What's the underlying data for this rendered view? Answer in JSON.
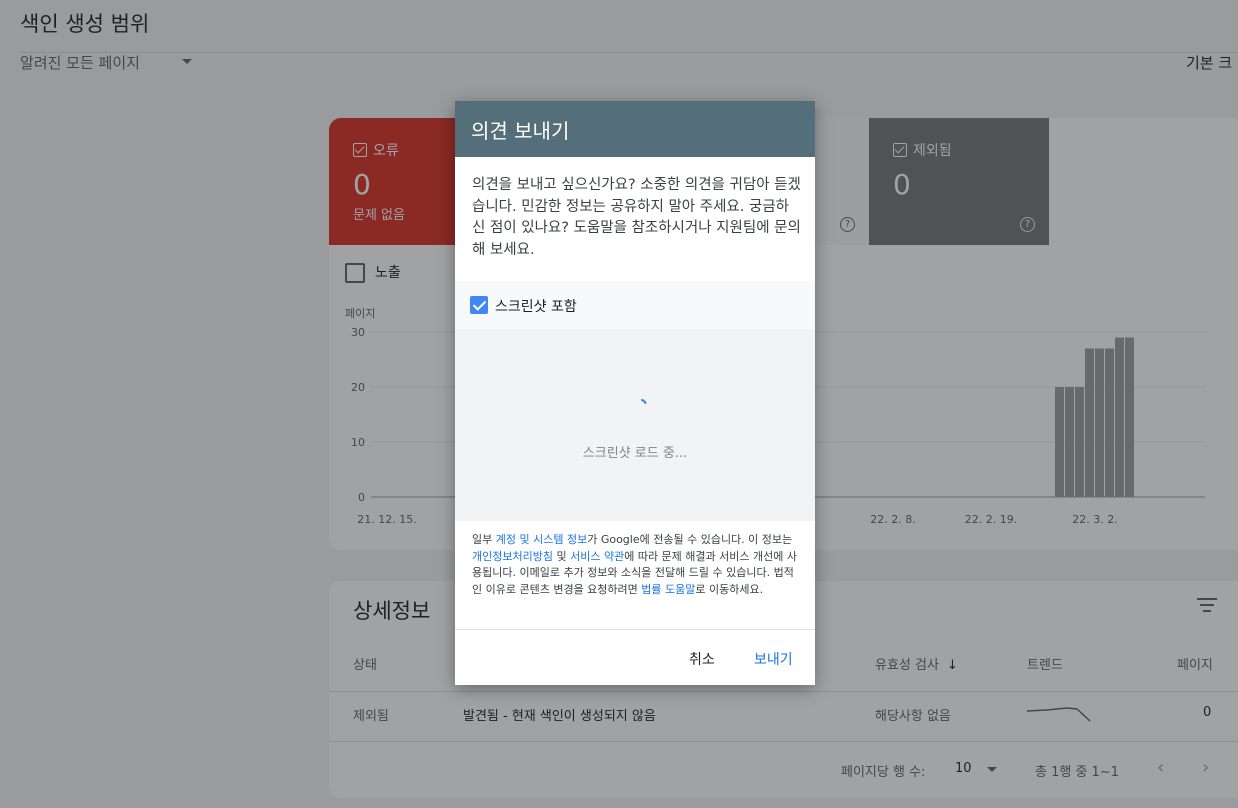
{
  "page": {
    "title": "색인 생성 범위",
    "filter_label": "알려진 모든 페이지",
    "top_right_text": "기본 크"
  },
  "summary": {
    "error": {
      "label": "오류",
      "count": "0",
      "sub": "문제 없음"
    },
    "excluded": {
      "label": "제외됨",
      "count": "0"
    },
    "impressions_label": "노출"
  },
  "chart_data": {
    "type": "bar",
    "ylabel": "페이지",
    "ylim": [
      0,
      30
    ],
    "yticks": [
      0,
      10,
      20,
      30
    ],
    "xtick_labels": [
      "21. 12. 15.",
      "22. 2. 8.",
      "22. 2. 19.",
      "22. 3. 2."
    ],
    "series": [
      {
        "color": "#9e9e9e",
        "values": [
          20,
          20,
          20,
          27,
          27,
          27,
          29,
          29
        ]
      }
    ]
  },
  "details": {
    "title": "상세정보",
    "columns": [
      "상태",
      "유효성 검사",
      "트렌드",
      "페이지"
    ],
    "rows": [
      {
        "status": "제외됨",
        "reason": "발견됨 - 현재 색인이 생성되지 않음",
        "validation": "해당사항 없음",
        "pages": "0"
      }
    ],
    "pagination": {
      "rows_per_page_label": "페이지당 행 수:",
      "rows_per_page": "10",
      "range": "총 1행 중 1~1"
    }
  },
  "dialog": {
    "title": "의견 보내기",
    "description": "의견을 보내고 싶으신가요? 소중한 의견을 귀담아 듣겠습니다. 민감한 정보는 공유하지 말아 주세요. 궁금하신 점이 있나요? 도움말을 참조하시거나 지원팀에 문의해 보세요.",
    "screenshot_label": "스크린샷 포함",
    "loading_text": "스크린샷 로드 중...",
    "legal": {
      "p1": "일부 ",
      "link1": "계정 및 시스템 정보",
      "p2": "가 Google에 전송될 수 있습니다. 이 정보는 ",
      "link2": "개인정보처리방침",
      "p3": " 및 ",
      "link3": "서비스 약관",
      "p4": "에 따라 문제 해결과 서비스 개선에 사용됩니다. 이메일로 추가 정보와 소식을 전달해 드릴 수 있습니다. 법적인 이유로 콘텐츠 변경을 요청하려면 ",
      "link4": "법률 도움말",
      "p5": "로 이동하세요."
    },
    "cancel_label": "취소",
    "send_label": "보내기",
    "accent_color": "#546e7a",
    "link_color": "#1a73e8"
  }
}
